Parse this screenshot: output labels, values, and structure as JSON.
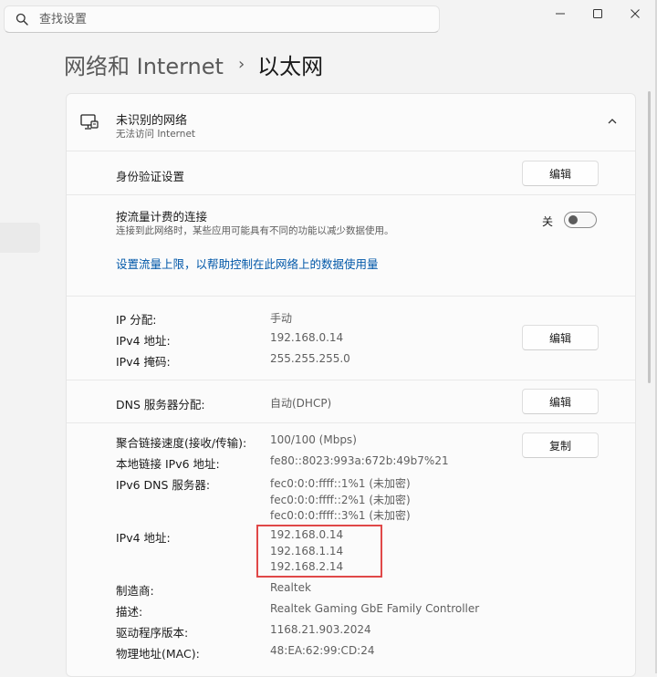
{
  "search": {
    "placeholder": "查找设置"
  },
  "window": {
    "minimize_glyph": "─",
    "maximize_glyph": "☐",
    "close_glyph": "✕"
  },
  "breadcrumb": {
    "parent": "网络和 Internet",
    "separator": "›",
    "current": "以太网"
  },
  "network": {
    "title": "未识别的网络",
    "subtitle": "无法访问 Internet"
  },
  "auth": {
    "label": "身份验证设置",
    "button": "编辑"
  },
  "metered": {
    "label": "按流量计费的连接",
    "description": "连接到此网络时，某些应用可能具有不同的功能以减少数据使用。",
    "toggle_state": "关",
    "toggle_on": false,
    "link": "设置流量上限，以帮助控制在此网络上的数据使用量"
  },
  "ip_section": {
    "rows": [
      {
        "label": "IP 分配:",
        "value": "手动"
      },
      {
        "label": "IPv4 地址:",
        "value": "192.168.0.14"
      },
      {
        "label": "IPv4 掩码:",
        "value": "255.255.255.0"
      }
    ],
    "button": "编辑"
  },
  "dns_section": {
    "label": "DNS 服务器分配:",
    "value": "自动(DHCP)",
    "button": "编辑"
  },
  "properties": {
    "button": "复制",
    "link_speed": {
      "label": "聚合链接速度(接收/传输):",
      "value": "100/100 (Mbps)"
    },
    "ipv6_link_local": {
      "label": "本地链接 IPv6 地址:",
      "value": "fe80::8023:993a:672b:49b7%21"
    },
    "ipv6_dns": {
      "label": "IPv6 DNS 服务器:",
      "values": [
        "fec0:0:0:ffff::1%1 (未加密)",
        "fec0:0:0:ffff::2%1 (未加密)",
        "fec0:0:0:ffff::3%1 (未加密)"
      ]
    },
    "ipv4": {
      "label": "IPv4 地址:",
      "values": [
        "192.168.0.14",
        "192.168.1.14",
        "192.168.2.14"
      ]
    },
    "manufacturer": {
      "label": "制造商:",
      "value": "Realtek"
    },
    "description": {
      "label": "描述:",
      "value": "Realtek Gaming GbE Family Controller"
    },
    "driver": {
      "label": "驱动程序版本:",
      "value": "1168.21.903.2024"
    },
    "mac": {
      "label": "物理地址(MAC):",
      "value": "48:EA:62:99:CD:24"
    }
  },
  "colors": {
    "accent_link": "#0057a8",
    "highlight_box": "#e04848"
  }
}
